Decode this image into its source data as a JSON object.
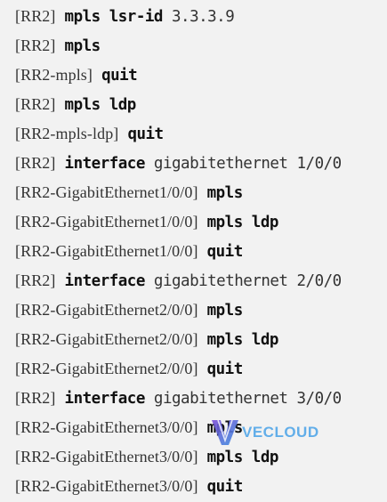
{
  "lines": [
    {
      "prompt": "[RR2]",
      "command": "mpls lsr-id",
      "args": "3.3.3.9"
    },
    {
      "prompt": "[RR2]",
      "command": "mpls",
      "args": ""
    },
    {
      "prompt": "[RR2-mpls]",
      "command": "quit",
      "args": ""
    },
    {
      "prompt": "[RR2]",
      "command": "mpls ldp",
      "args": ""
    },
    {
      "prompt": "[RR2-mpls-ldp]",
      "command": "quit",
      "args": ""
    },
    {
      "prompt": "[RR2]",
      "command": "interface",
      "args": "gigabitethernet 1/0/0"
    },
    {
      "prompt": "[RR2-GigabitEthernet1/0/0]",
      "command": "mpls",
      "args": ""
    },
    {
      "prompt": "[RR2-GigabitEthernet1/0/0]",
      "command": "mpls ldp",
      "args": ""
    },
    {
      "prompt": "[RR2-GigabitEthernet1/0/0]",
      "command": "quit",
      "args": ""
    },
    {
      "prompt": "[RR2]",
      "command": "interface",
      "args": "gigabitethernet 2/0/0"
    },
    {
      "prompt": "[RR2-GigabitEthernet2/0/0]",
      "command": "mpls",
      "args": ""
    },
    {
      "prompt": "[RR2-GigabitEthernet2/0/0]",
      "command": "mpls ldp",
      "args": ""
    },
    {
      "prompt": "[RR2-GigabitEthernet2/0/0]",
      "command": "quit",
      "args": ""
    },
    {
      "prompt": "[RR2]",
      "command": "interface",
      "args": "gigabitethernet 3/0/0"
    },
    {
      "prompt": "[RR2-GigabitEthernet3/0/0]",
      "command": "mpls",
      "args": ""
    },
    {
      "prompt": "[RR2-GigabitEthernet3/0/0]",
      "command": "mpls ldp",
      "args": ""
    },
    {
      "prompt": "[RR2-GigabitEthernet3/0/0]",
      "command": "quit",
      "args": ""
    }
  ],
  "watermark": {
    "text": "VECLOUD",
    "color": "#4aa3e8"
  },
  "colors": {
    "background": "#f2f2f2",
    "prompt": "#333333",
    "command": "#111111"
  }
}
